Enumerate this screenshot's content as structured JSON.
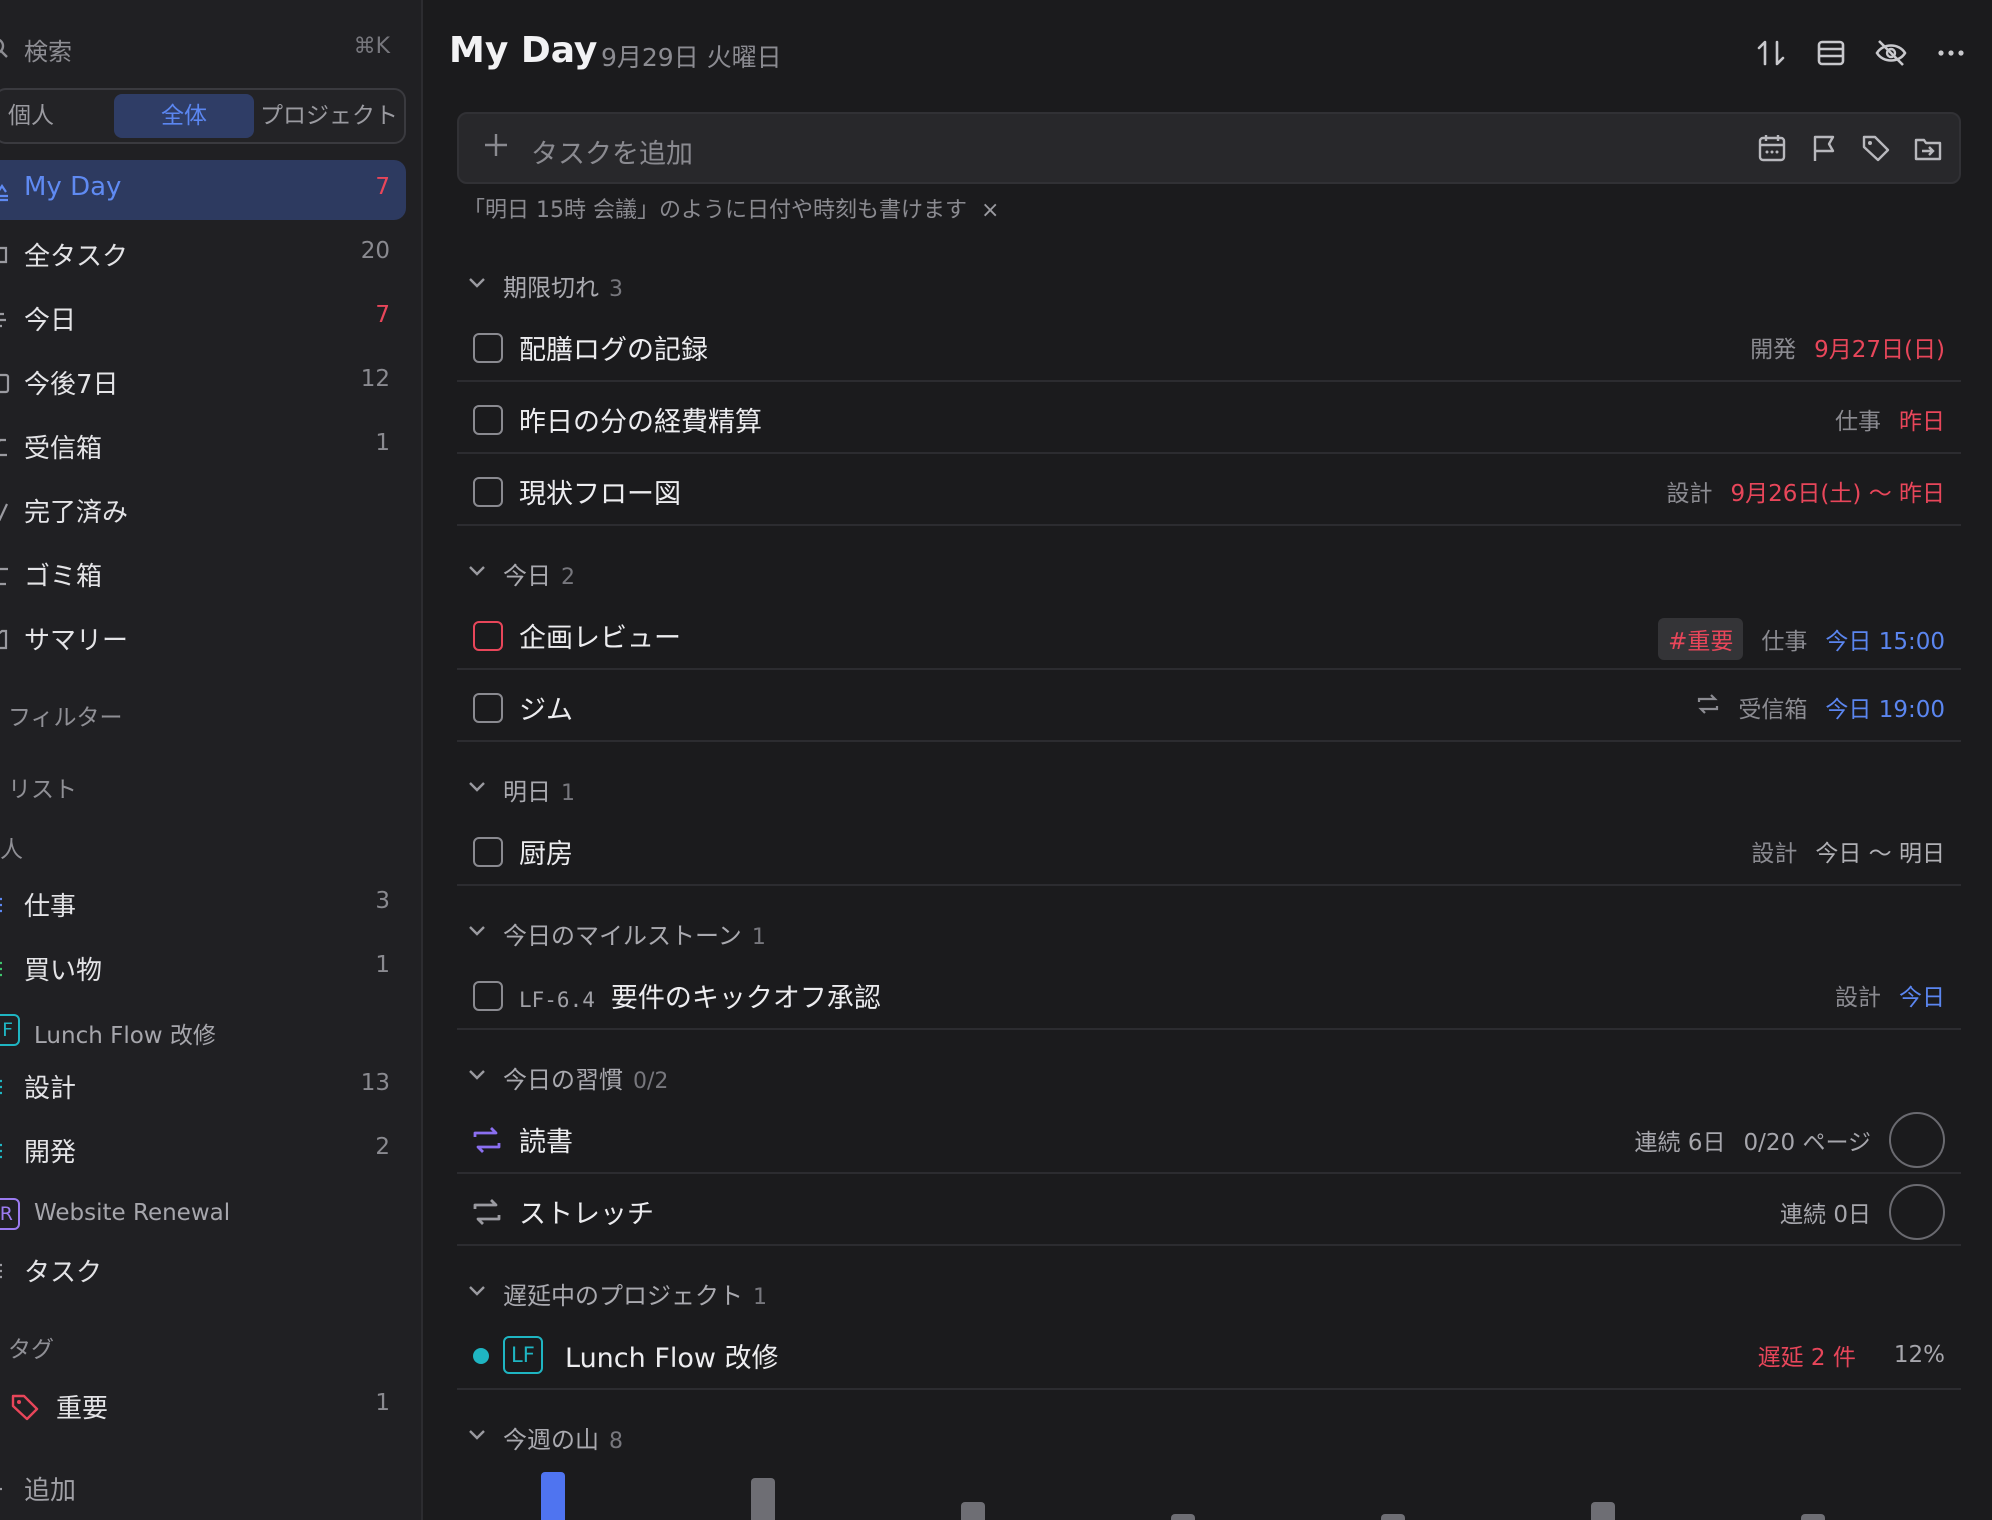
{
  "sidebar": {
    "search": {
      "label": "検索",
      "shortcut": "⌘K"
    },
    "scope_tabs": [
      {
        "label": "個人",
        "active": false
      },
      {
        "label": "全体",
        "active": true
      },
      {
        "label": "プロジェクト",
        "active": false
      }
    ],
    "nav": [
      {
        "label": "My Day",
        "count": "7",
        "count_color": "red",
        "active": true,
        "icon": "sun-icon"
      },
      {
        "label": "全タスク",
        "count": "20",
        "icon": "all-tasks-icon"
      },
      {
        "label": "今日",
        "count": "7",
        "count_color": "red",
        "icon": "today-icon"
      },
      {
        "label": "今後7日",
        "count": "12",
        "icon": "calendar-icon"
      },
      {
        "label": "受信箱",
        "count": "1",
        "icon": "inbox-icon"
      },
      {
        "label": "完了済み",
        "count": "",
        "icon": "check-icon"
      },
      {
        "label": "ゴミ箱",
        "count": "",
        "icon": "trash-icon"
      },
      {
        "label": "サマリー",
        "count": "",
        "icon": "summary-icon"
      }
    ],
    "sections": {
      "filters": "フィルター",
      "lists": "リスト",
      "personal": "人",
      "tags": "タグ",
      "add": "追加"
    },
    "personal_lists": [
      {
        "label": "仕事",
        "count": "3",
        "color": "#5b86f0"
      },
      {
        "label": "買い物",
        "count": "1",
        "color": "#3ec46d"
      }
    ],
    "projects": [
      {
        "badge": "F",
        "title": "Lunch Flow 改修",
        "color": "#1fb5c2",
        "lists": [
          {
            "label": "設計",
            "count": "13"
          },
          {
            "label": "開発",
            "count": "2"
          }
        ]
      },
      {
        "badge": "R",
        "title": "Website Renewal",
        "color": "#9b7bf0",
        "lists": [
          {
            "label": "タスク",
            "count": ""
          }
        ]
      }
    ],
    "tags": [
      {
        "label": "重要",
        "count": "1",
        "color": "#e8465a"
      }
    ]
  },
  "header": {
    "title": "My Day",
    "date": "9月29日 火曜日"
  },
  "add_task": {
    "placeholder": "タスクを追加",
    "hint": "「明日 15時 会議」のように日付や時刻も書けます",
    "hint_close": "×"
  },
  "groups": {
    "overdue": {
      "name": "期限切れ",
      "count": "3"
    },
    "today": {
      "name": "今日",
      "count": "2"
    },
    "tomorrow": {
      "name": "明日",
      "count": "1"
    },
    "milestones": {
      "name": "今日のマイルストーン",
      "count": "1"
    },
    "habits": {
      "name": "今日の習慣",
      "count": "0/2"
    },
    "delayed": {
      "name": "遅延中のプロジェクト",
      "count": "1"
    },
    "week": {
      "name": "今週の山",
      "count": "8"
    }
  },
  "tasks": {
    "t1": {
      "title": "配膳ログの記録",
      "project": "開発",
      "due": "9月27日(日)"
    },
    "t2": {
      "title": "昨日の分の経費精算",
      "project": "仕事",
      "due": "昨日"
    },
    "t3": {
      "title": "現状フロー図",
      "project": "設計",
      "due": "9月26日(土) 〜 昨日"
    },
    "t4": {
      "title": "企画レビュー",
      "tag": "#重要",
      "project": "仕事",
      "due": "今日 15:00"
    },
    "t5": {
      "title": "ジム",
      "project": "受信箱",
      "due": "今日 19:00",
      "repeat": true
    },
    "t6": {
      "title": "厨房",
      "project": "設計",
      "due": "今日 〜 明日"
    },
    "t7": {
      "code": "LF-6.4",
      "title": "要件のキックオフ承認",
      "project": "設計",
      "due": "今日"
    }
  },
  "habits": [
    {
      "title": "読書",
      "streak": "連続 6日",
      "progress": "0/20 ページ",
      "accent": "#8b6ff0"
    },
    {
      "title": "ストレッチ",
      "streak": "連続 0日",
      "progress": "",
      "accent": "#9a9aa0"
    }
  ],
  "delayed_project": {
    "badge": "LF",
    "title": "Lunch Flow 改修",
    "delay": "遅延 2 件",
    "percent": "12%",
    "color": "#1fb5c2"
  },
  "week_chart": {
    "type": "bar",
    "values": [
      8,
      7,
      3,
      1,
      1,
      3,
      1
    ],
    "highlight_index": 0,
    "colors": {
      "highlight": "#4f74f0",
      "normal": "#6e6e74"
    }
  }
}
